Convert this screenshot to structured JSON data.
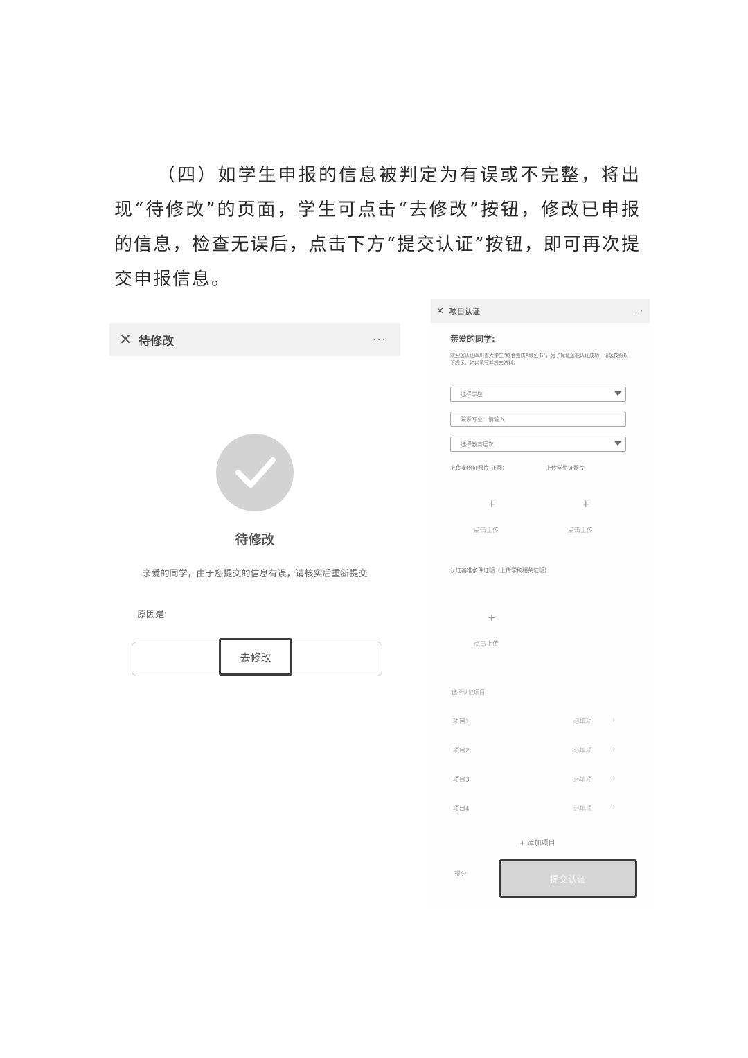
{
  "paragraph": "（四）如学生申报的信息被判定为有误或不完整，将出现“待修改”的页面，学生可点击“去修改”按钮，修改已申报的信息，检查无误后，点击下方“提交认证”按钮，即可再次提交申报信息。",
  "left_screen": {
    "title": "待修改",
    "more": "···",
    "status_title": "待修改",
    "message": "亲爱的同学，由于您提交的信息有误，请核实后重新提交",
    "reason_label": "原因是:",
    "modify_button": "去修改"
  },
  "right_screen": {
    "title": "项目认证",
    "more": "···",
    "greeting": "亲爱的同学:",
    "intro": "欢迎您认证四川省大学生“综合素质A级证书”，为了保证您能认证成功，请您按照以下提示，如实填写并提交资料。",
    "select_school": "选择学校",
    "major_field": "院系专业：请输入",
    "select_level": "选择教育层次",
    "upload_id_label": "上传身份证照片(正面)",
    "upload_student_card_label": "上传学生证照片",
    "upload_hint": "点击上传",
    "plus": "+",
    "cert_proof_label": "认证基准条件证明（上传学校相关证明）",
    "select_items_label": "选择认证项目",
    "items": [
      {
        "name": "项目1",
        "status": "必填项"
      },
      {
        "name": "项目2",
        "status": "必填项"
      },
      {
        "name": "项目3",
        "status": "必填项"
      },
      {
        "name": "项目4",
        "status": "必填项"
      }
    ],
    "add_item": "+ 添加项目",
    "score_label": "得分",
    "submit_button": "提交认证"
  }
}
